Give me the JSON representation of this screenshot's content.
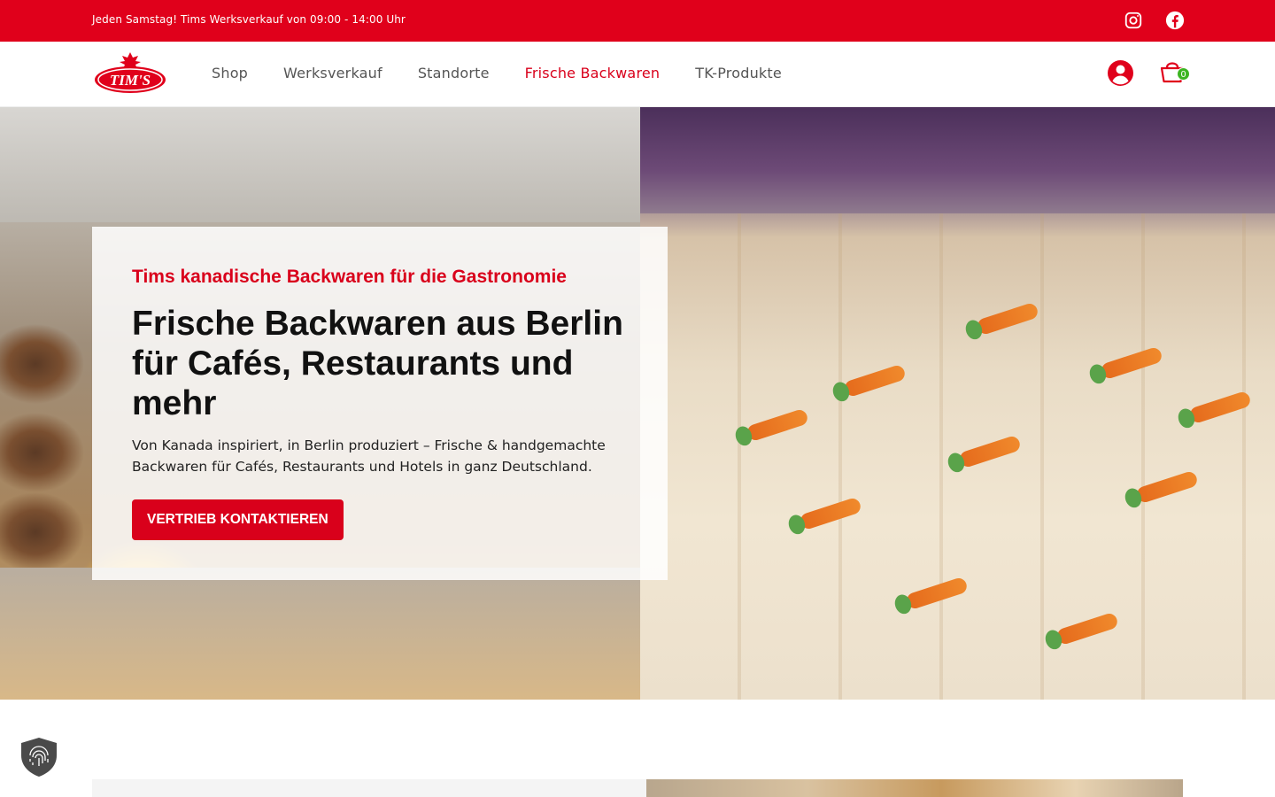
{
  "topbar": {
    "announcement": "Jeden Samstag! Tims Werksverkauf von 09:00 - 14:00 Uhr",
    "social": [
      {
        "icon": "instagram-icon"
      },
      {
        "icon": "facebook-icon"
      }
    ]
  },
  "header": {
    "logo_text": "TIM'S",
    "nav": [
      {
        "label": "Shop",
        "active": false
      },
      {
        "label": "Werksverkauf",
        "active": false
      },
      {
        "label": "Standorte",
        "active": false
      },
      {
        "label": "Frische Backwaren",
        "active": true
      },
      {
        "label": "TK-Produkte",
        "active": false
      }
    ],
    "cart_count": "0"
  },
  "hero": {
    "eyebrow": "Tims kanadische Backwaren für die Gastronomie",
    "title": "Frische Backwaren aus Berlin für Cafés, Restaurants und mehr",
    "subtitle": "Von Kanada inspiriert, in Berlin produziert – Frische & handgemachte Backwaren für Cafés, Restaurants und Hotels in ganz Deutschland.",
    "cta_label": "VERTRIEB KONTAKTIEREN"
  },
  "colors": {
    "brand_red": "#e0001b",
    "cart_badge": "#3cb521"
  }
}
